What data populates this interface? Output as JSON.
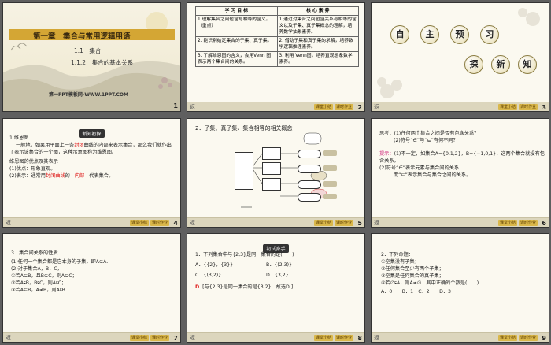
{
  "slides": [
    {
      "id": 1,
      "chapter_title": "第一章　集合与常用逻辑用语",
      "section": "1.1　集合",
      "subsection": "1.1.2　集合的基本关系",
      "template": "第一PPT模板网-WWW.1PPT.COM",
      "number": "1"
    },
    {
      "id": 2,
      "headers": [
        "学 习 目 标",
        "核 心 素 养"
      ],
      "rows": [
        [
          "1.理解集合之间包含与相等的含义。（重点）",
          "1.通过对集合之间包含关系与相等的含义以及子集、真子集概念的理解，培养数学抽象素养。"
        ],
        [
          "2. 能识别给定集合的子集、真子集。",
          "2. 借助子集和真子集的求解，培养数学逻辑推理素养。"
        ],
        [
          "3. 了解维恩图的含义，会用Venn 图表示两个集合间的关系。",
          "3. 利用 Venn图，培养直观想象数学素养。"
        ]
      ],
      "number": "2"
    },
    {
      "id": 3,
      "chars_top": [
        "自",
        "主",
        "预",
        "习"
      ],
      "chars_bottom": [
        "探",
        "新",
        "知"
      ],
      "number": "3"
    },
    {
      "id": 4,
      "tag": "新知初探",
      "h1": "1.维恩图",
      "p1a": "一般地，如果用平面上一条",
      "p1b": "封闭",
      "p1c": "曲线的内部来表示集合，那么我们就作出了表示该集合的一个图，这种示意图称为维恩图。",
      "h2": "维恩图的优点及其表示",
      "l1": "(1)优点：形象直观。",
      "l2a": "(2)表示：通常用",
      "l2b": "封闭曲线",
      "l2c": "的",
      "l2d": "内部",
      "l2e": "代表集合。",
      "number": "4"
    },
    {
      "id": 5,
      "title": "2．子集、真子集、集合相等的相关概念",
      "number": "5"
    },
    {
      "id": 6,
      "q": "思考：(1)任何两个集合之间是否有包含关系？",
      "q2": "(2)符号“∈”与“⊆”有何不同？",
      "hint_label": "提示：",
      "hint": "(1)不一定，如集合A={0,1,2}，B={−1,0,1}，这两个集合就没有包含关系。",
      "h2": "(2)符号“∈”表示元素与集合间的关系；",
      "h3": "而“⊆”表示集合与集合之间的关系。",
      "number": "6"
    },
    {
      "id": 7,
      "title": "3．集合间关系的性质",
      "l1": "(1)任何一个集合都是它本身的子集，即A⊆A.",
      "l2": "(2)对于集合A，B，C，",
      "l3": "①若A⊆B，且B⊆C，则A⊆C；",
      "l4": "②若A⫋B，B⫋C，则A⫋C；",
      "l5": "③若A⊆B，A≠B，则A⫋B.",
      "number": "7"
    },
    {
      "id": 8,
      "tag": "初试身手",
      "q": "1．下列集合中与{2,3}是同一集合的是(　　)",
      "a": "A．{{2}，{3}}",
      "b": "B．{(2,3)}",
      "c": "C．{(3,2)}",
      "d": "D．{3,2}",
      "ans_label": "D",
      "ans": "[与{2,3}是同一集合的是{3,2}．故选D.]",
      "number": "8"
    },
    {
      "id": 9,
      "title": "2．下列命题：",
      "l1": "①空集没有子集；",
      "l2": "②任何集合至少有两个子集；",
      "l3": "③空集是任何集合的真子集；",
      "l4": "④若∅⫋A，则A≠∅．其中正确的个数是(　　)",
      "opts": "A．0　　B．1　C．2　　D．3",
      "number": "9"
    }
  ],
  "footer": {
    "buttons": [
      "课堂小结",
      "课时作业"
    ],
    "left_label": "返"
  }
}
